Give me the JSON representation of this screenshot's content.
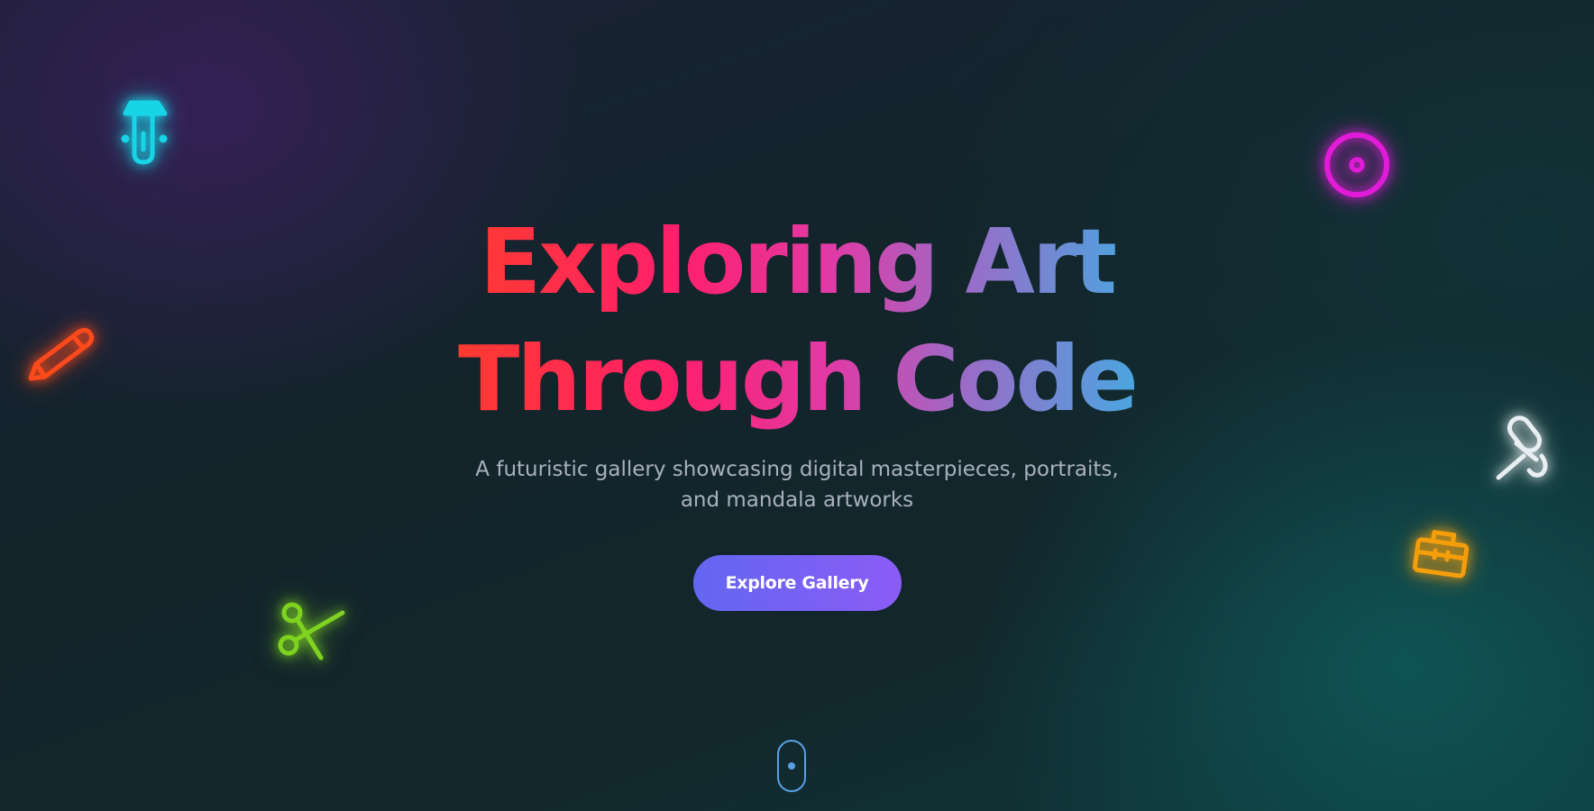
{
  "hero": {
    "title_line1": "Exploring Art",
    "title_line2": "Through Code",
    "subtitle": "A futuristic gallery showcasing digital masterpieces, portraits, and mandala artworks",
    "cta_label": "Explore Gallery"
  },
  "floating_icons": [
    {
      "name": "flask-icon",
      "color": "#17d4e6"
    },
    {
      "name": "pencil-icon",
      "color": "#ff4a1c"
    },
    {
      "name": "scissors-icon",
      "color": "#7ed321"
    },
    {
      "name": "target-icon",
      "color": "#e11bd8"
    },
    {
      "name": "microphone-icon",
      "color": "#ffffff"
    },
    {
      "name": "toolbox-icon",
      "color": "#f59e0b"
    }
  ],
  "scroll_indicator": {
    "icon": "mouse-scroll-icon",
    "color": "#5aa0e6"
  },
  "colors": {
    "title_gradient": [
      "#ff3b2f",
      "#ff1f6b",
      "#e13aa6",
      "#9a6cc7",
      "#4aa6e0"
    ],
    "button_gradient": [
      "#6366f1",
      "#8b5cf6"
    ],
    "background": "#12242a"
  }
}
